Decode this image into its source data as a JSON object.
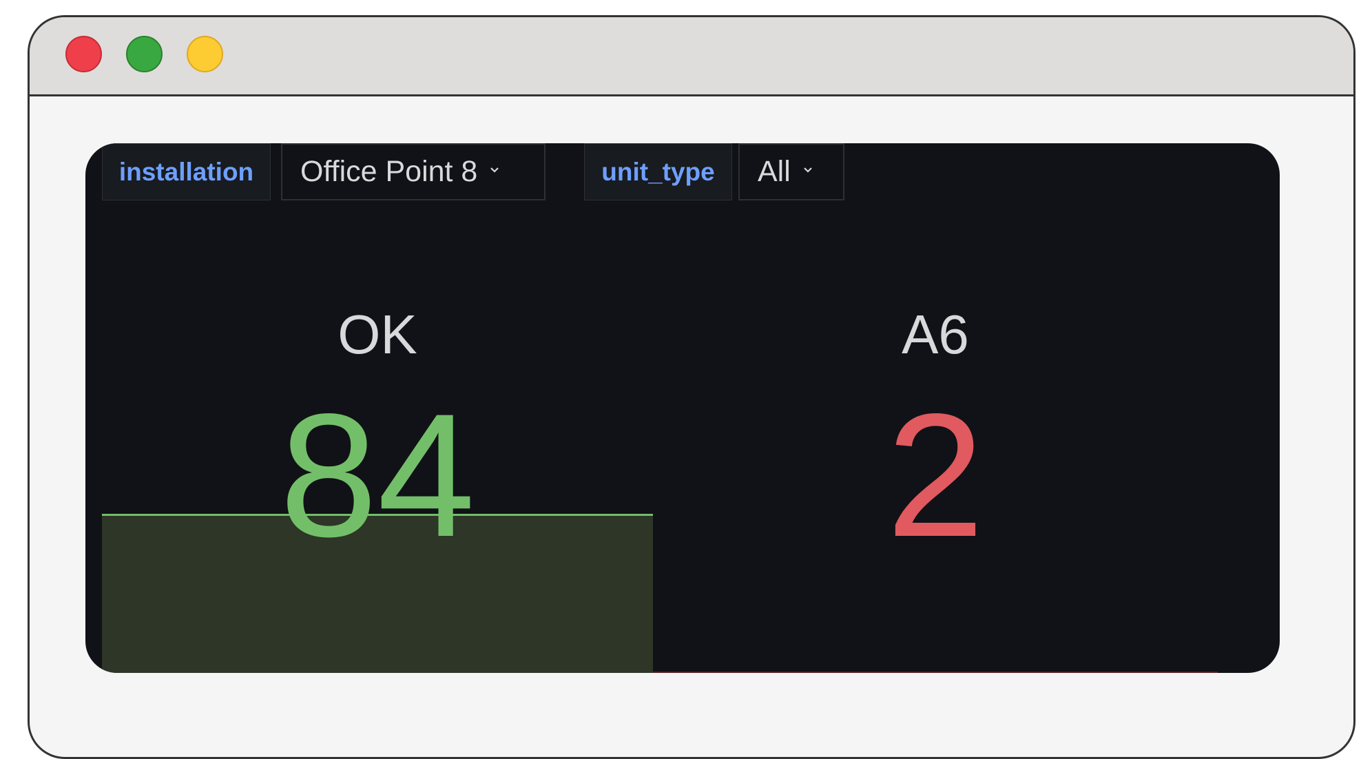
{
  "window": {
    "controls": [
      "close",
      "minimize",
      "zoom"
    ]
  },
  "variables": [
    {
      "label": "installation",
      "value": "Office Point 8"
    },
    {
      "label": "unit_type",
      "value": "All"
    }
  ],
  "panels": [
    {
      "title": "OK",
      "value": "84",
      "color": "#73bf69",
      "has_sparkline": true
    },
    {
      "title": "A6",
      "value": "2",
      "color": "#e05a60",
      "has_sparkline": false
    }
  ],
  "colors": {
    "background": "#111217",
    "variable_label": "#6e9fff",
    "ok": "#73bf69",
    "alert": "#e05a60"
  }
}
